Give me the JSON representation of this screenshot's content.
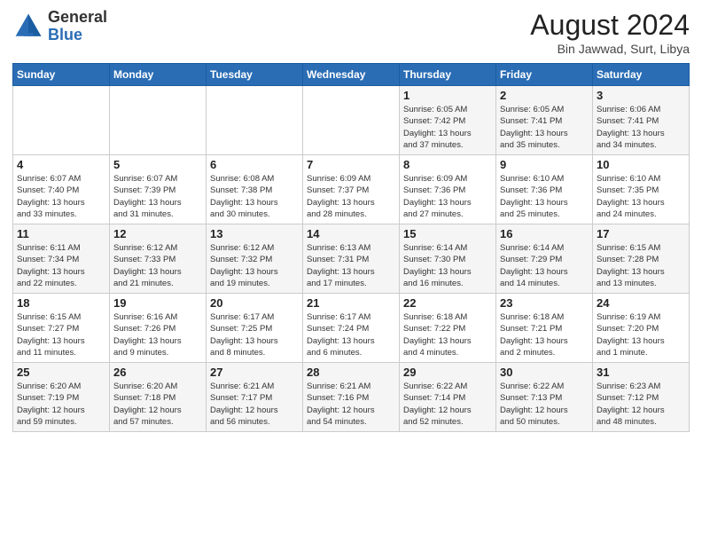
{
  "header": {
    "logo_general": "General",
    "logo_blue": "Blue",
    "title": "August 2024",
    "location": "Bin Jawwad, Surt, Libya"
  },
  "weekdays": [
    "Sunday",
    "Monday",
    "Tuesday",
    "Wednesday",
    "Thursday",
    "Friday",
    "Saturday"
  ],
  "weeks": [
    [
      {
        "day": "",
        "info": ""
      },
      {
        "day": "",
        "info": ""
      },
      {
        "day": "",
        "info": ""
      },
      {
        "day": "",
        "info": ""
      },
      {
        "day": "1",
        "info": "Sunrise: 6:05 AM\nSunset: 7:42 PM\nDaylight: 13 hours\nand 37 minutes."
      },
      {
        "day": "2",
        "info": "Sunrise: 6:05 AM\nSunset: 7:41 PM\nDaylight: 13 hours\nand 35 minutes."
      },
      {
        "day": "3",
        "info": "Sunrise: 6:06 AM\nSunset: 7:41 PM\nDaylight: 13 hours\nand 34 minutes."
      }
    ],
    [
      {
        "day": "4",
        "info": "Sunrise: 6:07 AM\nSunset: 7:40 PM\nDaylight: 13 hours\nand 33 minutes."
      },
      {
        "day": "5",
        "info": "Sunrise: 6:07 AM\nSunset: 7:39 PM\nDaylight: 13 hours\nand 31 minutes."
      },
      {
        "day": "6",
        "info": "Sunrise: 6:08 AM\nSunset: 7:38 PM\nDaylight: 13 hours\nand 30 minutes."
      },
      {
        "day": "7",
        "info": "Sunrise: 6:09 AM\nSunset: 7:37 PM\nDaylight: 13 hours\nand 28 minutes."
      },
      {
        "day": "8",
        "info": "Sunrise: 6:09 AM\nSunset: 7:36 PM\nDaylight: 13 hours\nand 27 minutes."
      },
      {
        "day": "9",
        "info": "Sunrise: 6:10 AM\nSunset: 7:36 PM\nDaylight: 13 hours\nand 25 minutes."
      },
      {
        "day": "10",
        "info": "Sunrise: 6:10 AM\nSunset: 7:35 PM\nDaylight: 13 hours\nand 24 minutes."
      }
    ],
    [
      {
        "day": "11",
        "info": "Sunrise: 6:11 AM\nSunset: 7:34 PM\nDaylight: 13 hours\nand 22 minutes."
      },
      {
        "day": "12",
        "info": "Sunrise: 6:12 AM\nSunset: 7:33 PM\nDaylight: 13 hours\nand 21 minutes."
      },
      {
        "day": "13",
        "info": "Sunrise: 6:12 AM\nSunset: 7:32 PM\nDaylight: 13 hours\nand 19 minutes."
      },
      {
        "day": "14",
        "info": "Sunrise: 6:13 AM\nSunset: 7:31 PM\nDaylight: 13 hours\nand 17 minutes."
      },
      {
        "day": "15",
        "info": "Sunrise: 6:14 AM\nSunset: 7:30 PM\nDaylight: 13 hours\nand 16 minutes."
      },
      {
        "day": "16",
        "info": "Sunrise: 6:14 AM\nSunset: 7:29 PM\nDaylight: 13 hours\nand 14 minutes."
      },
      {
        "day": "17",
        "info": "Sunrise: 6:15 AM\nSunset: 7:28 PM\nDaylight: 13 hours\nand 13 minutes."
      }
    ],
    [
      {
        "day": "18",
        "info": "Sunrise: 6:15 AM\nSunset: 7:27 PM\nDaylight: 13 hours\nand 11 minutes."
      },
      {
        "day": "19",
        "info": "Sunrise: 6:16 AM\nSunset: 7:26 PM\nDaylight: 13 hours\nand 9 minutes."
      },
      {
        "day": "20",
        "info": "Sunrise: 6:17 AM\nSunset: 7:25 PM\nDaylight: 13 hours\nand 8 minutes."
      },
      {
        "day": "21",
        "info": "Sunrise: 6:17 AM\nSunset: 7:24 PM\nDaylight: 13 hours\nand 6 minutes."
      },
      {
        "day": "22",
        "info": "Sunrise: 6:18 AM\nSunset: 7:22 PM\nDaylight: 13 hours\nand 4 minutes."
      },
      {
        "day": "23",
        "info": "Sunrise: 6:18 AM\nSunset: 7:21 PM\nDaylight: 13 hours\nand 2 minutes."
      },
      {
        "day": "24",
        "info": "Sunrise: 6:19 AM\nSunset: 7:20 PM\nDaylight: 13 hours\nand 1 minute."
      }
    ],
    [
      {
        "day": "25",
        "info": "Sunrise: 6:20 AM\nSunset: 7:19 PM\nDaylight: 12 hours\nand 59 minutes."
      },
      {
        "day": "26",
        "info": "Sunrise: 6:20 AM\nSunset: 7:18 PM\nDaylight: 12 hours\nand 57 minutes."
      },
      {
        "day": "27",
        "info": "Sunrise: 6:21 AM\nSunset: 7:17 PM\nDaylight: 12 hours\nand 56 minutes."
      },
      {
        "day": "28",
        "info": "Sunrise: 6:21 AM\nSunset: 7:16 PM\nDaylight: 12 hours\nand 54 minutes."
      },
      {
        "day": "29",
        "info": "Sunrise: 6:22 AM\nSunset: 7:14 PM\nDaylight: 12 hours\nand 52 minutes."
      },
      {
        "day": "30",
        "info": "Sunrise: 6:22 AM\nSunset: 7:13 PM\nDaylight: 12 hours\nand 50 minutes."
      },
      {
        "day": "31",
        "info": "Sunrise: 6:23 AM\nSunset: 7:12 PM\nDaylight: 12 hours\nand 48 minutes."
      }
    ]
  ]
}
